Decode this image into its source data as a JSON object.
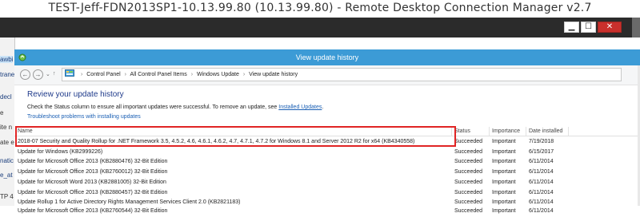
{
  "app": {
    "window_title": "TEST-Jeff-FDN2013SP1-10.13.99.80 (10.13.99.80) - Remote Desktop Connection Manager v2.7"
  },
  "window_controls": {
    "minimize": "▁",
    "maximize": "☐",
    "close": "✕"
  },
  "left_fragments": [
    "awbi",
    "trane",
    "decl",
    "e",
    "ite n",
    "ate e",
    "natic",
    "e_at",
    "TP 4"
  ],
  "remote_window": {
    "title": "View update history"
  },
  "navigation": {
    "back": "←",
    "forward": "→",
    "recent": "⌄",
    "up": "↑",
    "breadcrumb": [
      "Control Panel",
      "All Control Panel Items",
      "Windows Update",
      "View update history"
    ],
    "separator": "›"
  },
  "page": {
    "heading": "Review your update history",
    "description_prefix": "Check the Status column to ensure all important updates were successful. To remove an update, see ",
    "description_link": "Installed Updates",
    "description_suffix": ".",
    "troubleshoot_link": "Troubleshoot problems with installing updates"
  },
  "table": {
    "columns": [
      "Name",
      "Status",
      "Importance",
      "Date installed"
    ],
    "rows": [
      {
        "name": "2018-07 Security and Quality Rollup for .NET Framework 3.5, 4.5.2, 4.6, 4.6.1, 4.6.2, 4.7, 4.7.1, 4.7.2 for Windows 8.1 and Server 2012 R2 for x64 (KB4340558)",
        "status": "Succeeded",
        "importance": "Important",
        "date": "7/19/2018"
      },
      {
        "name": "Update for Windows (KB2999226)",
        "status": "Succeeded",
        "importance": "Important",
        "date": "6/15/2017"
      },
      {
        "name": "Update for Microsoft Office 2013 (KB2880476) 32-Bit Edition",
        "status": "Succeeded",
        "importance": "Important",
        "date": "6/11/2014"
      },
      {
        "name": "Update for Microsoft Office 2013 (KB2760012) 32-Bit Edition",
        "status": "Succeeded",
        "importance": "Important",
        "date": "6/11/2014"
      },
      {
        "name": "Update for Microsoft Word 2013 (KB2881005) 32-Bit Edition",
        "status": "Succeeded",
        "importance": "Important",
        "date": "6/11/2014"
      },
      {
        "name": "Update for Microsoft Office 2013 (KB2880457) 32-Bit Edition",
        "status": "Succeeded",
        "importance": "Important",
        "date": "6/11/2014"
      },
      {
        "name": "Update Rollup 1 for Active Directory Rights Management Services Client 2.0 (KB2821183)",
        "status": "Succeeded",
        "importance": "Important",
        "date": "6/11/2014"
      },
      {
        "name": "Update for Microsoft Office 2013 (KB2760544) 32-Bit Edition",
        "status": "Succeeded",
        "importance": "Important",
        "date": "6/11/2014"
      }
    ]
  },
  "colors": {
    "title_bar": "#3c9bd6",
    "link": "#1a5fb4",
    "heading": "#1e3a8a",
    "highlight": "#e02424"
  }
}
